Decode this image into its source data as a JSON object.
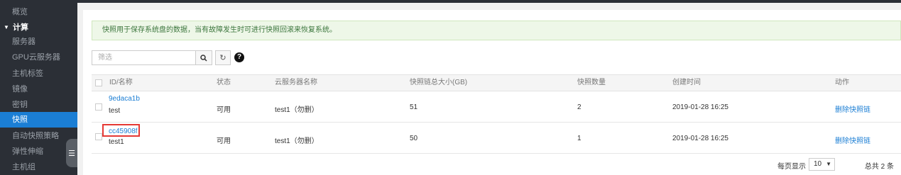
{
  "sidebar": {
    "items": [
      {
        "label": "概览"
      },
      {
        "label": "计算",
        "section": true
      },
      {
        "label": "服务器"
      },
      {
        "label": "GPU云服务器"
      },
      {
        "label": "主机标签"
      },
      {
        "label": "镜像"
      },
      {
        "label": "密钥"
      },
      {
        "label": "快照",
        "active": true
      },
      {
        "label": "自动快照策略"
      },
      {
        "label": "弹性伸缩"
      },
      {
        "label": "主机组"
      }
    ]
  },
  "alert": {
    "text": "快照用于保存系统盘的数据，当有故障发生时可进行快照回滚来恢复系统。"
  },
  "toolbar": {
    "filter_placeholder": "筛选"
  },
  "table": {
    "columns": [
      "ID/名称",
      "状态",
      "云服务器名称",
      "快照链总大小(GB)",
      "快照数量",
      "创建时间",
      "动作"
    ],
    "rows": [
      {
        "id": "9edaca1b",
        "name": "test",
        "status": "可用",
        "server": "test1（勿删）",
        "size": "51",
        "count": "2",
        "created": "2019-01-28 16:25",
        "action": "删除快照链"
      },
      {
        "id": "cc45908f",
        "name": "test1",
        "status": "可用",
        "server": "test1（勿删）",
        "size": "50",
        "count": "1",
        "created": "2019-01-28 16:25",
        "action": "删除快照链"
      }
    ]
  },
  "pager": {
    "per_page_label": "每页显示",
    "per_page": "10",
    "total": "总共 2 条"
  },
  "colors": {
    "sidebar_bg": "#2b2f36",
    "active": "#1b7ed4",
    "alert_bg": "#eef7e8",
    "highlight": "#e53935"
  }
}
